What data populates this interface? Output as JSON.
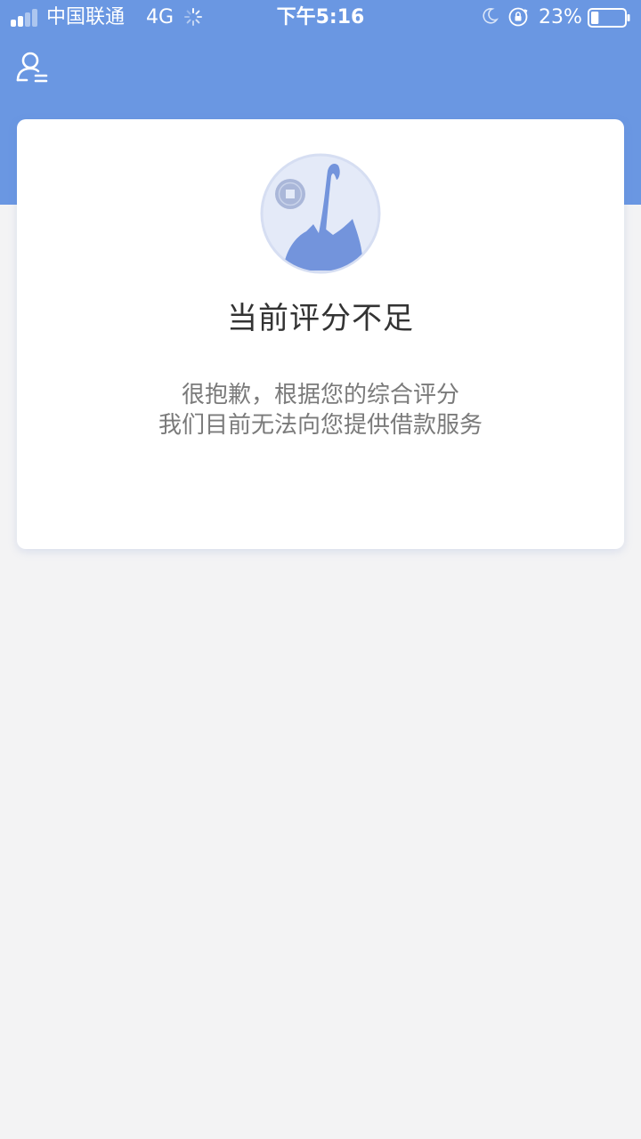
{
  "status_bar": {
    "carrier": "中国联通",
    "network": "4G",
    "time": "下午5:16",
    "battery_percent": "23%",
    "battery_level": 0.23,
    "icons": [
      "signal-icon",
      "loading-spinner-icon",
      "moon-icon",
      "orientation-lock-icon",
      "battery-icon"
    ]
  },
  "header": {
    "icon": "user-menu-icon",
    "color": "#6a97e2"
  },
  "card": {
    "illustration": "money-bag-illustration",
    "title": "当前评分不足",
    "message_line1": "很抱歉，根据您的综合评分",
    "message_line2": "我们目前无法向您提供借款服务"
  },
  "colors": {
    "accent": "#6a97e2",
    "background": "#f3f3f4",
    "card": "#ffffff",
    "title_text": "#333333",
    "body_text": "#7a7a7a"
  }
}
